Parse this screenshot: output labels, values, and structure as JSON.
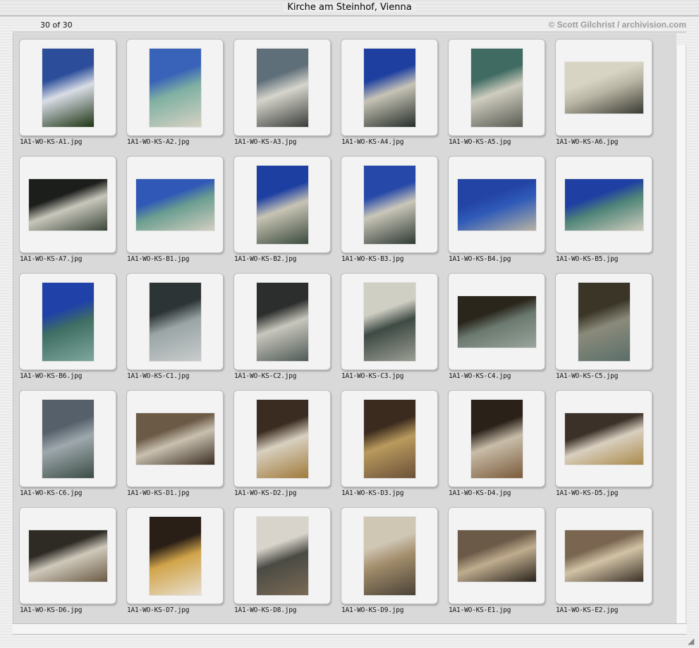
{
  "window": {
    "title": "Kirche am Steinhof, Vienna",
    "count_label": "30 of 30",
    "credit": "© Scott Gilchrist / archivision.com",
    "resize_glyph": "◢"
  },
  "slides": [
    {
      "name": "1A1-WO-KS-A1.jpg",
      "orientation": "portrait",
      "colors": [
        "#2c4e9a",
        "#d9dde6",
        "#1d3514"
      ]
    },
    {
      "name": "1A1-WO-KS-A2.jpg",
      "orientation": "portrait",
      "colors": [
        "#3863b8",
        "#7fb0a2",
        "#d6d2c3"
      ]
    },
    {
      "name": "1A1-WO-KS-A3.jpg",
      "orientation": "portrait",
      "colors": [
        "#5f6f7a",
        "#d6d5cc",
        "#3a3d3a"
      ]
    },
    {
      "name": "1A1-WO-KS-A4.jpg",
      "orientation": "portrait",
      "colors": [
        "#1e3fa0",
        "#c7c4b6",
        "#262e2a"
      ]
    },
    {
      "name": "1A1-WO-KS-A5.jpg",
      "orientation": "portrait",
      "colors": [
        "#3f6b62",
        "#cfcdbf",
        "#585a52"
      ]
    },
    {
      "name": "1A1-WO-KS-A6.jpg",
      "orientation": "landscape",
      "colors": [
        "#d8d4c4",
        "#b9b5a4",
        "#3a3a32"
      ]
    },
    {
      "name": "1A1-WO-KS-A7.jpg",
      "orientation": "landscape",
      "colors": [
        "#1c1e1b",
        "#c9c7bc",
        "#3a4639"
      ]
    },
    {
      "name": "1A1-WO-KS-B1.jpg",
      "orientation": "landscape",
      "colors": [
        "#2f58b7",
        "#6b9e90",
        "#d2cfc1"
      ]
    },
    {
      "name": "1A1-WO-KS-B2.jpg",
      "orientation": "portrait",
      "colors": [
        "#1d3fa2",
        "#c8c4b4",
        "#3a4a3e"
      ]
    },
    {
      "name": "1A1-WO-KS-B3.jpg",
      "orientation": "portrait",
      "colors": [
        "#2648a8",
        "#cac7b9",
        "#2e3a34"
      ]
    },
    {
      "name": "1A1-WO-KS-B4.jpg",
      "orientation": "landscape",
      "colors": [
        "#2344a4",
        "#2f5ab8",
        "#b8b4a2"
      ]
    },
    {
      "name": "1A1-WO-KS-B5.jpg",
      "orientation": "landscape",
      "colors": [
        "#1f40a2",
        "#4f8478",
        "#cfccbd"
      ]
    },
    {
      "name": "1A1-WO-KS-B6.jpg",
      "orientation": "portrait",
      "colors": [
        "#1f41a8",
        "#3f6e63",
        "#7ea79c"
      ]
    },
    {
      "name": "1A1-WO-KS-C1.jpg",
      "orientation": "portrait",
      "colors": [
        "#2d3436",
        "#9aa5a6",
        "#c9cccc"
      ]
    },
    {
      "name": "1A1-WO-KS-C2.jpg",
      "orientation": "portrait",
      "colors": [
        "#2b2e2c",
        "#c8c6bd",
        "#4f5a56"
      ]
    },
    {
      "name": "1A1-WO-KS-C3.jpg",
      "orientation": "portrait",
      "colors": [
        "#cfcfc4",
        "#3e4a44",
        "#9b9e94"
      ]
    },
    {
      "name": "1A1-WO-KS-C4.jpg",
      "orientation": "landscape",
      "colors": [
        "#2b261c",
        "#6b7a70",
        "#9aa59c"
      ]
    },
    {
      "name": "1A1-WO-KS-C5.jpg",
      "orientation": "portrait",
      "colors": [
        "#3a3527",
        "#8b8a7b",
        "#5a6f69"
      ]
    },
    {
      "name": "1A1-WO-KS-C6.jpg",
      "orientation": "portrait",
      "colors": [
        "#56606a",
        "#9ea8ad",
        "#3b4c45"
      ]
    },
    {
      "name": "1A1-WO-KS-D1.jpg",
      "orientation": "landscape",
      "colors": [
        "#6b5a46",
        "#c9c0b0",
        "#3a2e22"
      ]
    },
    {
      "name": "1A1-WO-KS-D2.jpg",
      "orientation": "portrait",
      "colors": [
        "#3a2c20",
        "#d8d0c0",
        "#a07a3a"
      ]
    },
    {
      "name": "1A1-WO-KS-D3.jpg",
      "orientation": "portrait",
      "colors": [
        "#3b2a1e",
        "#b99a5e",
        "#6b5038"
      ]
    },
    {
      "name": "1A1-WO-KS-D4.jpg",
      "orientation": "portrait",
      "colors": [
        "#2a2119",
        "#c8bda9",
        "#7b5a3a"
      ]
    },
    {
      "name": "1A1-WO-KS-D5.jpg",
      "orientation": "landscape",
      "colors": [
        "#3c3128",
        "#d9cfbf",
        "#a98a4a"
      ]
    },
    {
      "name": "1A1-WO-KS-D6.jpg",
      "orientation": "landscape",
      "colors": [
        "#2e2a24",
        "#cfc9bb",
        "#6a5a44"
      ]
    },
    {
      "name": "1A1-WO-KS-D7.jpg",
      "orientation": "portrait",
      "colors": [
        "#2a1f16",
        "#d1a44a",
        "#e8dfcf"
      ]
    },
    {
      "name": "1A1-WO-KS-D8.jpg",
      "orientation": "portrait",
      "colors": [
        "#d8d4cb",
        "#4a4a44",
        "#7a6a55"
      ]
    },
    {
      "name": "1A1-WO-KS-D9.jpg",
      "orientation": "portrait",
      "colors": [
        "#cfc6b4",
        "#a48f6d",
        "#4a4136"
      ]
    },
    {
      "name": "1A1-WO-KS-E1.jpg",
      "orientation": "landscape",
      "colors": [
        "#6b5a48",
        "#c0ad8f",
        "#2a241d"
      ]
    },
    {
      "name": "1A1-WO-KS-E2.jpg",
      "orientation": "landscape",
      "colors": [
        "#7a6650",
        "#d2c3a6",
        "#3a3026"
      ]
    }
  ]
}
